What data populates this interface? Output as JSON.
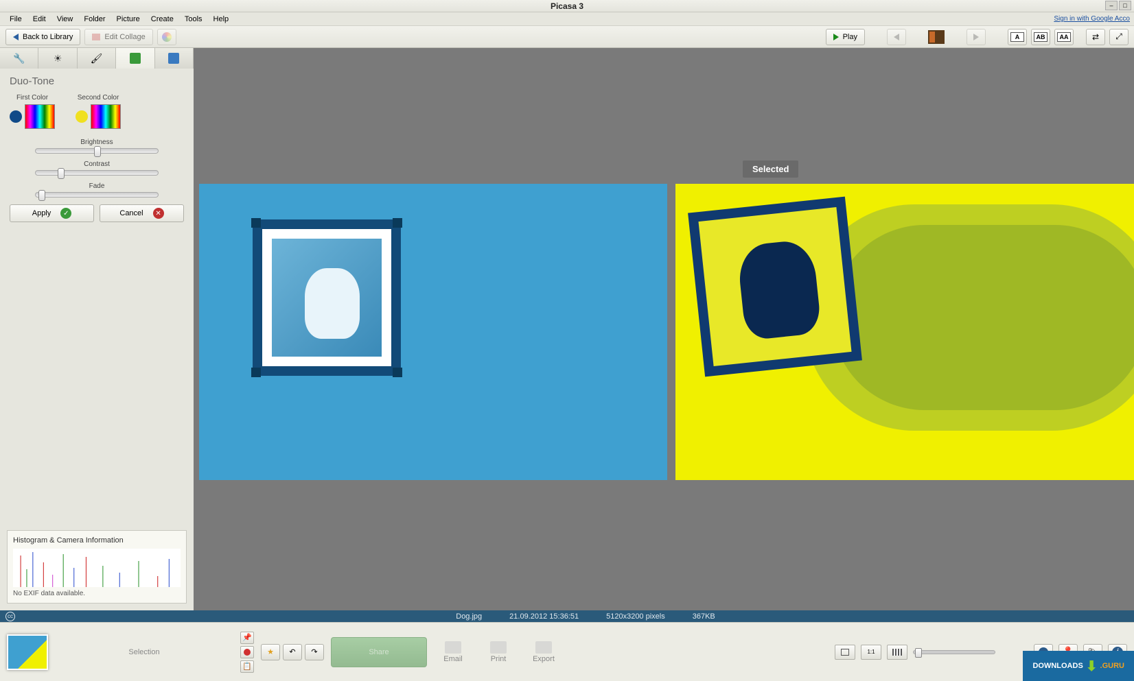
{
  "window": {
    "title": "Picasa 3",
    "signin": "Sign in with Google Acco"
  },
  "menu": [
    "File",
    "Edit",
    "View",
    "Folder",
    "Picture",
    "Create",
    "Tools",
    "Help"
  ],
  "toolbar": {
    "back_label": "Back to Library",
    "edit_collage": "Edit Collage",
    "play": "Play",
    "text_buttons": [
      "A",
      "AB",
      "AA"
    ]
  },
  "panel": {
    "title": "Duo-Tone",
    "first_color_label": "First Color",
    "second_color_label": "Second Color",
    "first_color": "#104a88",
    "second_color": "#f0e020",
    "sliders": {
      "brightness": {
        "label": "Brightness",
        "pos": 48
      },
      "contrast": {
        "label": "Contrast",
        "pos": 18
      },
      "fade": {
        "label": "Fade",
        "pos": 2
      }
    },
    "apply": "Apply",
    "cancel": "Cancel"
  },
  "histogram": {
    "title": "Histogram & Camera Information",
    "exif": "No EXIF data available."
  },
  "canvas": {
    "selected_badge": "Selected"
  },
  "status": {
    "filename": "Dog.jpg",
    "datetime": "21.09.2012 15:36:51",
    "dimensions": "5120x3200 pixels",
    "filesize": "367KB"
  },
  "tray": {
    "selection_label": "Selection",
    "share": "Share",
    "actions": [
      "Email",
      "Print",
      "Export"
    ]
  },
  "watermark": {
    "a": "DOWNLOADS",
    "b": ".GURU"
  }
}
